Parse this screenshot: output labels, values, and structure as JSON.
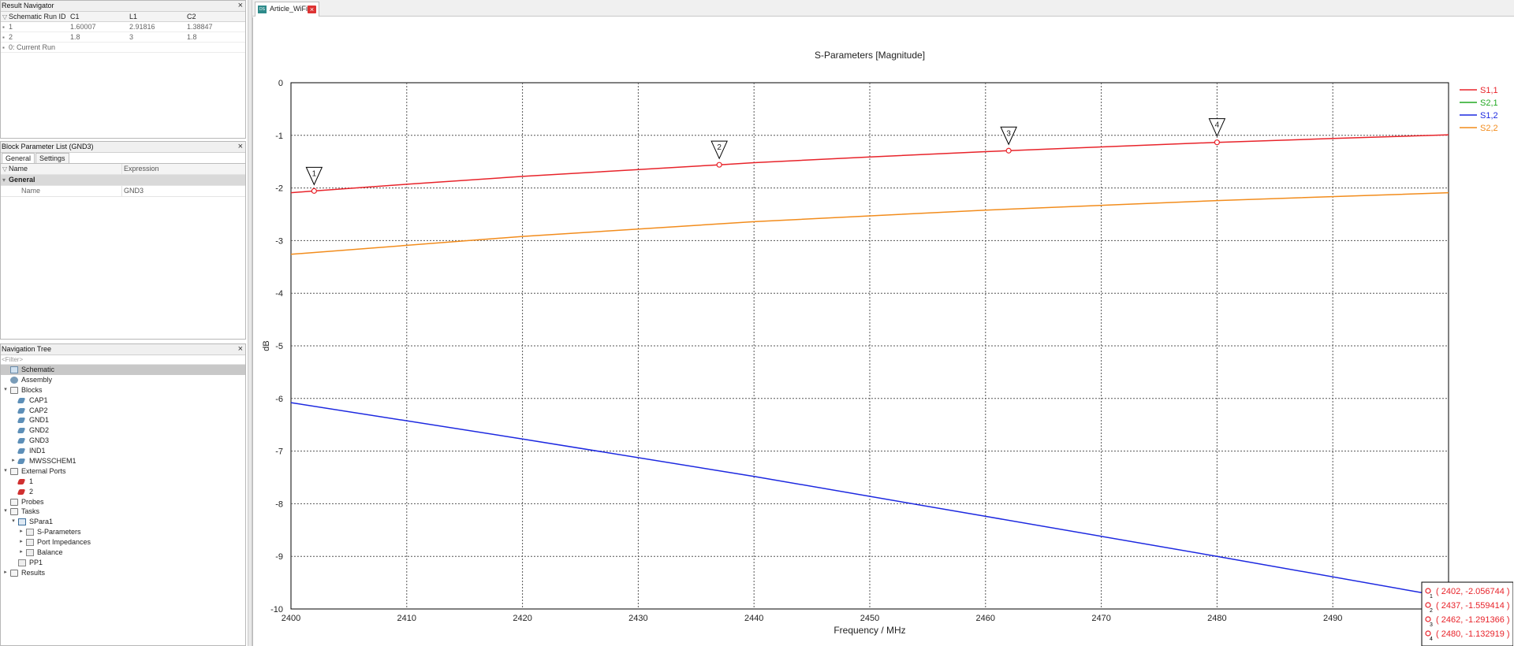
{
  "result_navigator": {
    "title": "Result Navigator",
    "columns": [
      "Schematic Run ID",
      "C1",
      "L1",
      "C2"
    ],
    "rows": [
      [
        "1",
        "1.60007",
        "2.91816",
        "1.38847"
      ],
      [
        "2",
        "1.8",
        "3",
        "1.8"
      ],
      [
        "0: Current Run",
        "",
        "",
        ""
      ]
    ]
  },
  "block_params": {
    "title": "Block Parameter List (GND3)",
    "tabs": [
      "General",
      "Settings"
    ],
    "columns": [
      "Name",
      "Expression"
    ],
    "group": "General",
    "rows": [
      [
        "Name",
        "GND3"
      ]
    ]
  },
  "nav_tree": {
    "title": "Navigation Tree",
    "filter_placeholder": "<Filter>",
    "items": [
      {
        "label": "Schematic",
        "level": 0,
        "arrow": "",
        "icon": "schematic-icon",
        "selected": true
      },
      {
        "label": "Assembly",
        "level": 0,
        "arrow": "",
        "icon": "assembly-icon"
      },
      {
        "label": "Blocks",
        "level": 0,
        "arrow": "▾",
        "icon": "folder-icon"
      },
      {
        "label": "CAP1",
        "level": 1,
        "arrow": "",
        "icon": "block-icon"
      },
      {
        "label": "CAP2",
        "level": 1,
        "arrow": "",
        "icon": "block-icon"
      },
      {
        "label": "GND1",
        "level": 1,
        "arrow": "",
        "icon": "block-icon"
      },
      {
        "label": "GND2",
        "level": 1,
        "arrow": "",
        "icon": "block-icon"
      },
      {
        "label": "GND3",
        "level": 1,
        "arrow": "",
        "icon": "block-icon"
      },
      {
        "label": "IND1",
        "level": 1,
        "arrow": "",
        "icon": "block-icon"
      },
      {
        "label": "MWSSCHEM1",
        "level": 1,
        "arrow": "▸",
        "icon": "block-icon"
      },
      {
        "label": "External Ports",
        "level": 0,
        "arrow": "▾",
        "icon": "folder-icon"
      },
      {
        "label": "1",
        "level": 1,
        "arrow": "",
        "icon": "port-icon"
      },
      {
        "label": "2",
        "level": 1,
        "arrow": "",
        "icon": "port-icon"
      },
      {
        "label": "Probes",
        "level": 0,
        "arrow": "",
        "icon": "folder-icon"
      },
      {
        "label": "Tasks",
        "level": 0,
        "arrow": "▾",
        "icon": "folder-icon"
      },
      {
        "label": "SPara1",
        "level": 1,
        "arrow": "▾",
        "icon": "task-icon"
      },
      {
        "label": "S-Parameters",
        "level": 2,
        "arrow": "▸",
        "icon": "result-icon"
      },
      {
        "label": "Port Impedances",
        "level": 2,
        "arrow": "▸",
        "icon": "result-icon"
      },
      {
        "label": "Balance",
        "level": 2,
        "arrow": "▸",
        "icon": "result-icon"
      },
      {
        "label": "PP1",
        "level": 1,
        "arrow": "",
        "icon": "postprocess-icon"
      },
      {
        "label": "Results",
        "level": 0,
        "arrow": "▸",
        "icon": "folder-icon"
      }
    ]
  },
  "document": {
    "tab_label": "Article_WiFi*",
    "tab_icon_text": "DS"
  },
  "icons": {
    "close": "×",
    "filter": "▽"
  },
  "chart_data": {
    "type": "line",
    "title": "S-Parameters [Magnitude]",
    "xlabel": "Frequency / MHz",
    "ylabel": "dB",
    "xlim": [
      2400,
      2500
    ],
    "ylim": [
      -10,
      0
    ],
    "xticks": [
      2400,
      2410,
      2420,
      2430,
      2440,
      2450,
      2460,
      2470,
      2480,
      2490
    ],
    "yticks": [
      0,
      -1,
      -2,
      -3,
      -4,
      -5,
      -6,
      -7,
      -8,
      -9,
      -10
    ],
    "grid": true,
    "legend_position": "right",
    "series": [
      {
        "name": "S1,1",
        "color": "#e8232a",
        "x": [
          2400,
          2402,
          2410,
          2420,
          2430,
          2437,
          2440,
          2450,
          2460,
          2462,
          2470,
          2480,
          2490,
          2500
        ],
        "y": [
          -2.09,
          -2.056744,
          -1.93,
          -1.78,
          -1.65,
          -1.559414,
          -1.52,
          -1.41,
          -1.31,
          -1.291366,
          -1.22,
          -1.132919,
          -1.06,
          -0.99
        ]
      },
      {
        "name": "S2,1",
        "color": "#22a822",
        "x": [],
        "y": []
      },
      {
        "name": "S1,2",
        "color": "#1c28e0",
        "x": [
          2400,
          2420,
          2440,
          2460,
          2480,
          2500
        ],
        "y": [
          -6.08,
          -6.77,
          -7.48,
          -8.24,
          -9.0,
          -9.78
        ]
      },
      {
        "name": "S2,2",
        "color": "#f28c1c",
        "x": [
          2400,
          2420,
          2440,
          2460,
          2480,
          2500
        ],
        "y": [
          -3.26,
          -2.92,
          -2.64,
          -2.42,
          -2.24,
          -2.09
        ]
      }
    ],
    "markers": [
      {
        "id": "1",
        "x": 2402,
        "y": -2.056744,
        "label": "( 2402, -2.056744 )"
      },
      {
        "id": "2",
        "x": 2437,
        "y": -1.559414,
        "label": "( 2437, -1.559414 )"
      },
      {
        "id": "3",
        "x": 2462,
        "y": -1.291366,
        "label": "( 2462, -1.291366 )"
      },
      {
        "id": "4",
        "x": 2480,
        "y": -1.132919,
        "label": "( 2480, -1.132919 )"
      }
    ]
  }
}
